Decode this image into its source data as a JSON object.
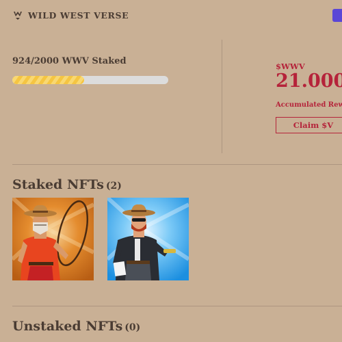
{
  "header": {
    "brand": "WILD WEST VERSE",
    "logo_icon": "cowboy-hat-icon"
  },
  "staking": {
    "progress_text": "924/2000 WWV Staked",
    "progress_staked": 924,
    "progress_total": 2000
  },
  "rewards": {
    "token_label": "$WWV",
    "amount": "21.000",
    "caption": "Accumulated Rew",
    "claim_label": "Claim $V"
  },
  "staked": {
    "title": "Staked NFTs",
    "count": "(2)",
    "items": [
      {
        "name": "nft-cowboy-lasso",
        "background": "orange"
      },
      {
        "name": "nft-cowboy-jacket",
        "background": "blue"
      }
    ]
  },
  "unstaked": {
    "title": "Unstaked NFTs",
    "count": "(0)"
  },
  "colors": {
    "page_bg": "#c9b095",
    "accent_red": "#b5233a",
    "text_dark": "#4a3c33",
    "progress_yellow": "#f5c542",
    "button_purple": "#5a46d6"
  }
}
